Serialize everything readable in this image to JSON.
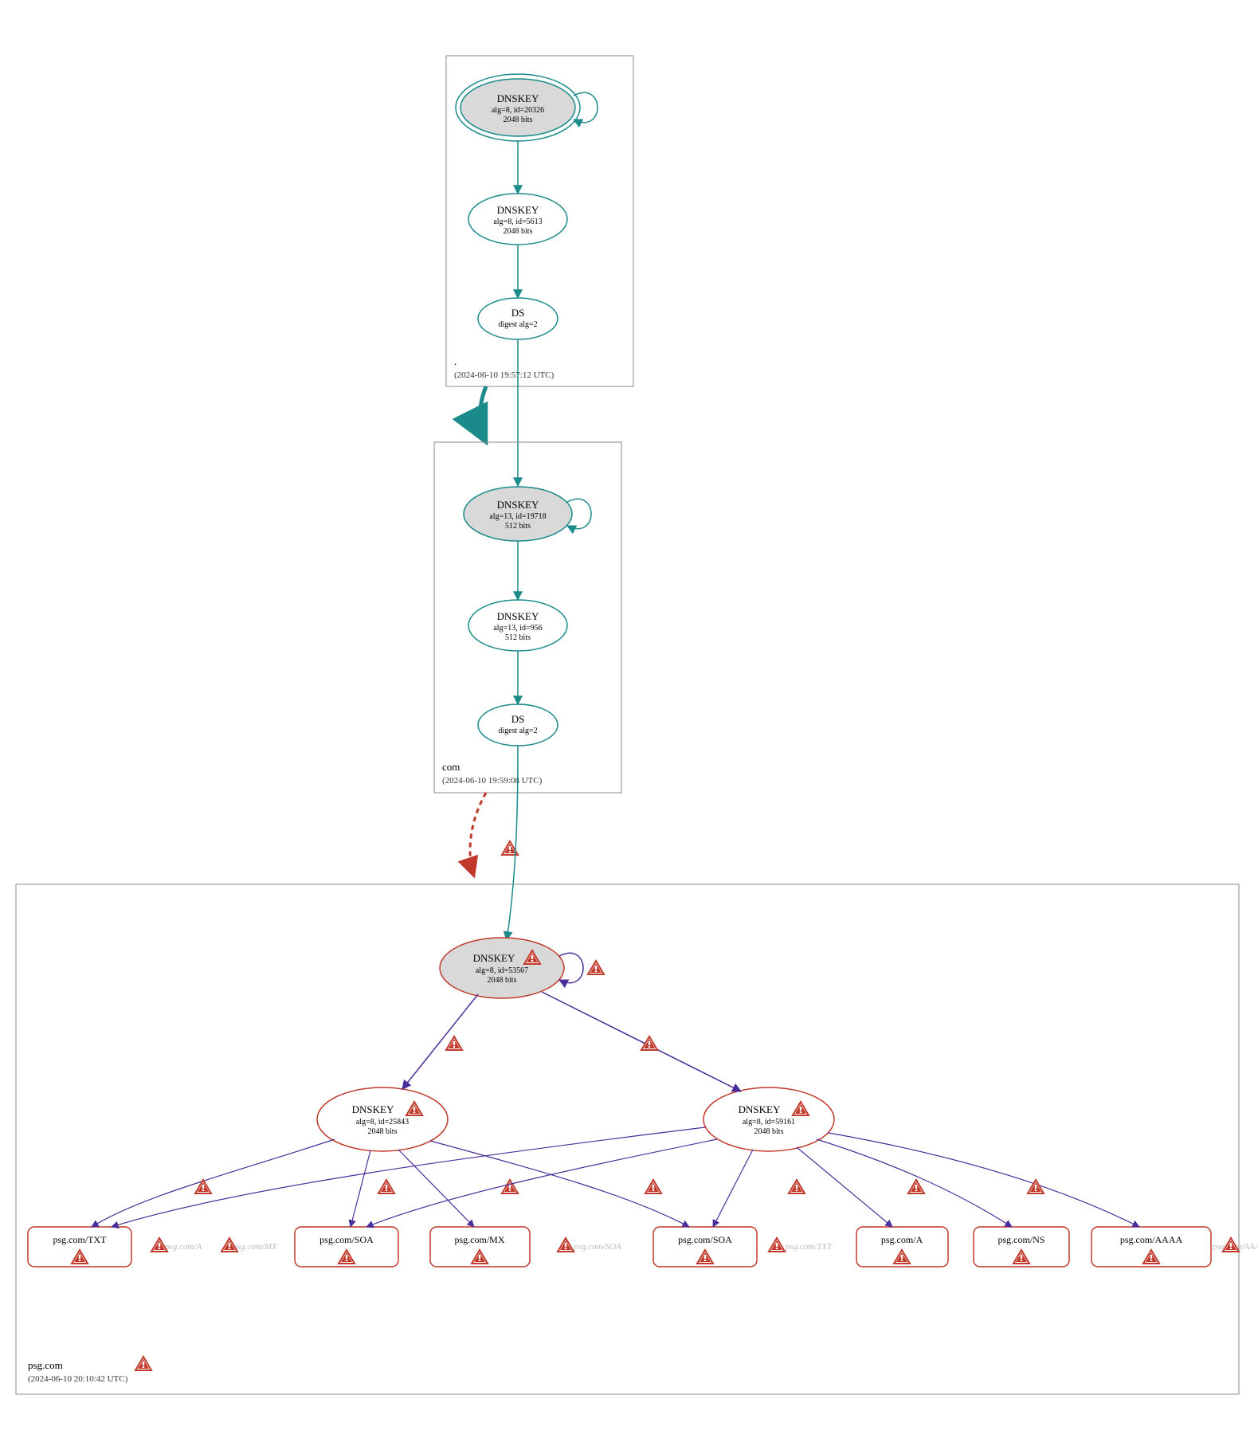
{
  "zones": {
    "root": {
      "name": ".",
      "timestamp": "(2024-06-10 19:57:12 UTC)"
    },
    "com": {
      "name": "com",
      "timestamp": "(2024-06-10 19:59:08 UTC)"
    },
    "psg": {
      "name": "psg.com",
      "timestamp": "(2024-06-10 20:10:42 UTC)"
    }
  },
  "nodes": {
    "root_ksk": {
      "title": "DNSKEY",
      "line2": "alg=8, id=20326",
      "line3": "2048 bits"
    },
    "root_zsk": {
      "title": "DNSKEY",
      "line2": "alg=8, id=5613",
      "line3": "2048 bits"
    },
    "root_ds": {
      "title": "DS",
      "line2": "digest alg=2",
      "line3": ""
    },
    "com_ksk": {
      "title": "DNSKEY",
      "line2": "alg=13, id=19718",
      "line3": "512 bits"
    },
    "com_zsk": {
      "title": "DNSKEY",
      "line2": "alg=13, id=956",
      "line3": "512 bits"
    },
    "com_ds": {
      "title": "DS",
      "line2": "digest alg=2",
      "line3": ""
    },
    "psg_ksk": {
      "title": "DNSKEY",
      "line2": "alg=8, id=53567",
      "line3": "2048 bits"
    },
    "psg_zsk1": {
      "title": "DNSKEY",
      "line2": "alg=8, id=25843",
      "line3": "2048 bits"
    },
    "psg_zsk2": {
      "title": "DNSKEY",
      "line2": "alg=8, id=59161",
      "line3": "2048 bits"
    }
  },
  "rrsets": {
    "txt": "psg.com/TXT",
    "soa1": "psg.com/SOA",
    "mx": "psg.com/MX",
    "soa2": "psg.com/SOA",
    "a": "psg.com/A",
    "ns": "psg.com/NS",
    "aaaa": "psg.com/AAAA"
  },
  "ghosts": {
    "a": "psg.com/A",
    "mx": "psg.com/MX",
    "soa": "psg.com/SOA",
    "txt": "psg.com/TXT",
    "aaaa": "psg.com/AAAA"
  },
  "colors": {
    "teal": "#1a8a8a",
    "purple": "#4b2e9b",
    "red": "#c0392b",
    "grey": "#d9d9d9"
  }
}
